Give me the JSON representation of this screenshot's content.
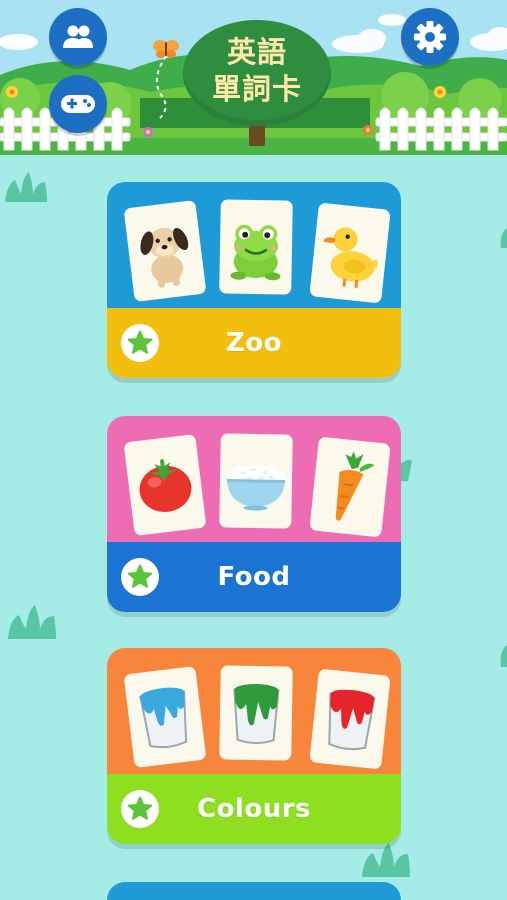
{
  "header": {
    "title_line1": "英語",
    "title_line2": "單詞卡"
  },
  "buttons": {
    "users_icon": "users-icon",
    "game_icon": "gamepad-icon",
    "settings_icon": "gear-icon"
  },
  "categories": [
    {
      "label": "Zoo",
      "top_color": "#1e9ad6",
      "bar_color": "#f2bf0f",
      "items": [
        "dog",
        "frog",
        "duck"
      ]
    },
    {
      "label": "Food",
      "top_color": "#ee6cb4",
      "bar_color": "#1b73d3",
      "items": [
        "tomato",
        "rice-bowl",
        "carrot"
      ]
    },
    {
      "label": "Colours",
      "top_color": "#f7853c",
      "bar_color": "#8ddf1f",
      "items": [
        "blue-paint-bucket",
        "green-paint-bucket",
        "red-paint-bucket"
      ]
    }
  ],
  "colors": {
    "background": "#a6ece6",
    "header_button": "#1d6fc4",
    "title_tree": "#2f8d3f",
    "title_text": "#ffe9a8"
  }
}
